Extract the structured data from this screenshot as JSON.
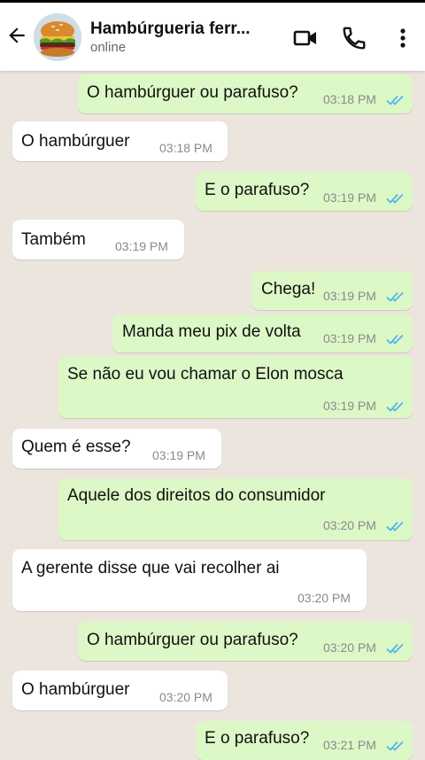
{
  "header": {
    "title": "Hambúrgueria ferr...",
    "status": "online"
  },
  "colors": {
    "outgoing": "#dcf8c6",
    "incoming": "#ffffff",
    "read_ticks": "#4fb6ec",
    "background": "#ece5dd"
  },
  "messages": [
    {
      "text": "O hambúrguer ou parafuso?",
      "time": "03:18 PM",
      "direction": "out",
      "read": true
    },
    {
      "text": "O hambúrguer",
      "time": "03:18 PM",
      "direction": "in"
    },
    {
      "text": "E o parafuso?",
      "time": "03:19 PM",
      "direction": "out",
      "read": true
    },
    {
      "text": "Também",
      "time": "03:19 PM",
      "direction": "in"
    },
    {
      "text": "Chega!",
      "time": "03:19 PM",
      "direction": "out",
      "read": true
    },
    {
      "text": "Manda meu pix de volta",
      "time": "03:19 PM",
      "direction": "out",
      "read": true
    },
    {
      "text": "Se não eu vou chamar o Elon mosca",
      "time": "03:19 PM",
      "direction": "out",
      "read": true
    },
    {
      "text": "Quem é esse?",
      "time": "03:19 PM",
      "direction": "in"
    },
    {
      "text": "Aquele dos direitos do consumidor",
      "time": "03:20 PM",
      "direction": "out",
      "read": true
    },
    {
      "text": "A gerente disse que vai recolher ai",
      "time": "03:20 PM",
      "direction": "in"
    },
    {
      "text": "O hambúrguer ou parafuso?",
      "time": "03:20 PM",
      "direction": "out",
      "read": true
    },
    {
      "text": "O hambúrguer",
      "time": "03:20 PM",
      "direction": "in"
    },
    {
      "text": "E o parafuso?",
      "time": "03:21 PM",
      "direction": "out",
      "read": true
    }
  ]
}
